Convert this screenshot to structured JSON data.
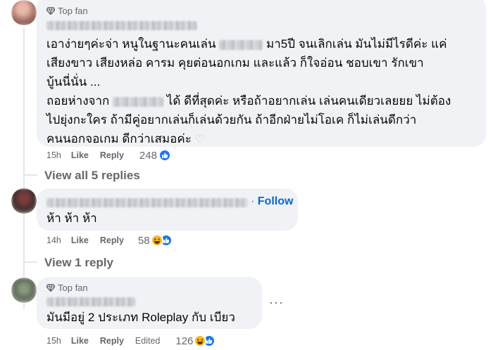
{
  "colors": {
    "bubble": "#f0f2f5",
    "meta_text": "#65676b",
    "follow_blue": "#0566d8",
    "like_blue": "#1877f2",
    "haha_yellow": "#f7b928"
  },
  "comments": [
    {
      "badge": "Top fan",
      "text": {
        "l1a": "เอาง่ายๆค่ะจ่า หนูในฐานะคนเล่น",
        "l1b": "มา5ปี จนเลิกเล่น มันไม่มีไรดีค่ะ แค่",
        "l2": "เสียงขาว เสียงหล่อ คารม คุยต่อนอกเกม และแล้ว ก็ใจอ่อน ชอบเขา รักเขา",
        "l3": "บู้นนี่นั่น ...",
        "l4a": "ถอยห่างจาก",
        "l4b": "ได้ ดีที่สุดค่ะ หรือถ้าอยากเล่น เล่นคนเดียวเลยยย ไม่ต้อง",
        "l5": "ไปยุ่งกะใคร ถ้ามีคู่อยากเล่นก็เล่นด้วยกัน ถ้าอีกฝ่ายไม่โอเค ก็ไม่เล่นดีกว่า",
        "l6": "คนนอกจอเกม ดีกว่าเสมอค่ะ",
        "heart": "♡"
      },
      "time": "15h",
      "like": "Like",
      "reply": "Reply",
      "reactions": 248,
      "reaction_icons": [
        "like-icon"
      ]
    },
    {
      "view_replies": "View all 5 replies"
    },
    {
      "follow": "Follow",
      "text": "ห้า ห้า ห้า",
      "time": "14h",
      "like": "Like",
      "reply": "Reply",
      "reactions": 58,
      "reaction_icons": [
        "haha-icon",
        "like-icon"
      ]
    },
    {
      "view_replies": "View 1 reply"
    },
    {
      "badge": "Top fan",
      "text": "มันมีอยู่ 2 ประเภท Roleplay กับ เบียว",
      "more": "···",
      "time": "15h",
      "like": "Like",
      "reply": "Reply",
      "edited": "Edited",
      "reactions": 126,
      "reaction_icons": [
        "haha-icon",
        "like-icon"
      ]
    }
  ]
}
